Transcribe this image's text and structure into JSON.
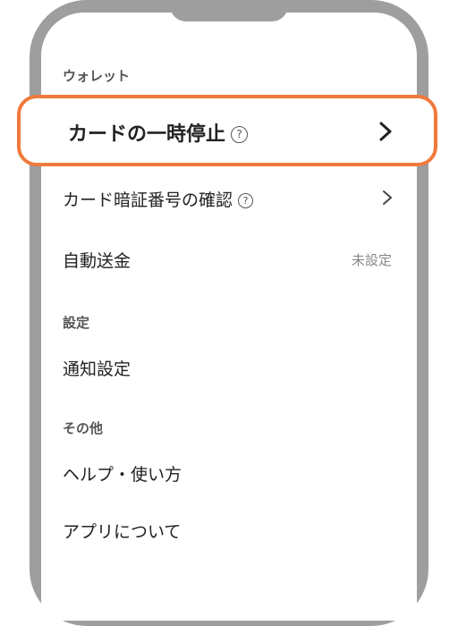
{
  "wallet": {
    "section_title": "ウォレット",
    "pause_card": {
      "label": "カードの一時停止",
      "help_icon": "?"
    },
    "card_pin": {
      "label": "カード暗証番号の確認",
      "help_icon": "?"
    },
    "auto_transfer": {
      "label": "自動送金",
      "status": "未設定"
    }
  },
  "settings": {
    "section_title": "設定",
    "notification": {
      "label": "通知設定"
    }
  },
  "other": {
    "section_title": "その他",
    "help_usage": {
      "label": "ヘルプ・使い方"
    },
    "about_app": {
      "label": "アプリについて"
    }
  },
  "colors": {
    "highlight": "#f07a3c",
    "frame": "#9e9e9e"
  },
  "icons": {
    "chevron": "chevron-right-icon",
    "help": "help-circle-icon"
  }
}
